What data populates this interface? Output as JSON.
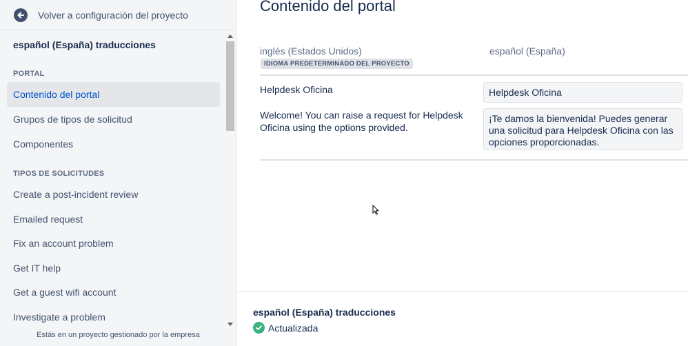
{
  "sidebar": {
    "back_label": "Volver a configuración del proyecto",
    "title": "español (España) traducciones",
    "sections": [
      {
        "header": "PORTAL"
      },
      {
        "header": "TIPOS DE SOLICITUDES"
      }
    ],
    "portal_items": [
      {
        "label": "Contenido del portal",
        "active": true
      },
      {
        "label": "Grupos de tipos de solicitud"
      },
      {
        "label": "Componentes"
      }
    ],
    "request_items": [
      {
        "label": "Create a post-incident review"
      },
      {
        "label": "Emailed request"
      },
      {
        "label": "Fix an account problem"
      },
      {
        "label": "Get IT help"
      },
      {
        "label": "Get a guest wifi account"
      },
      {
        "label": "Investigate a problem"
      }
    ],
    "footer_note": "Estás en un proyecto gestionado por la empresa"
  },
  "main": {
    "title": "Contenido del portal",
    "source_language": "inglés (Estados Unidos)",
    "target_language": "español (España)",
    "default_badge": "IDIOMA PREDETERMINADO DEL PROYECTO",
    "rows": [
      {
        "source": "Helpdesk Oficina",
        "translation": "Helpdesk Oficina"
      },
      {
        "source": "Welcome! You can raise a request for Helpdesk Oficina using the options provided.",
        "translation": "¡Te damos la bienvenida! Puedes generar una solicitud para Helpdesk Oficina con las opciones proporcionadas."
      }
    ]
  },
  "status": {
    "title": "español (España) traducciones",
    "state": "Actualizada",
    "state_color": "#36b37e"
  },
  "colors": {
    "accent": "#0052cc",
    "sidebar_bg": "#f4f5f7"
  }
}
